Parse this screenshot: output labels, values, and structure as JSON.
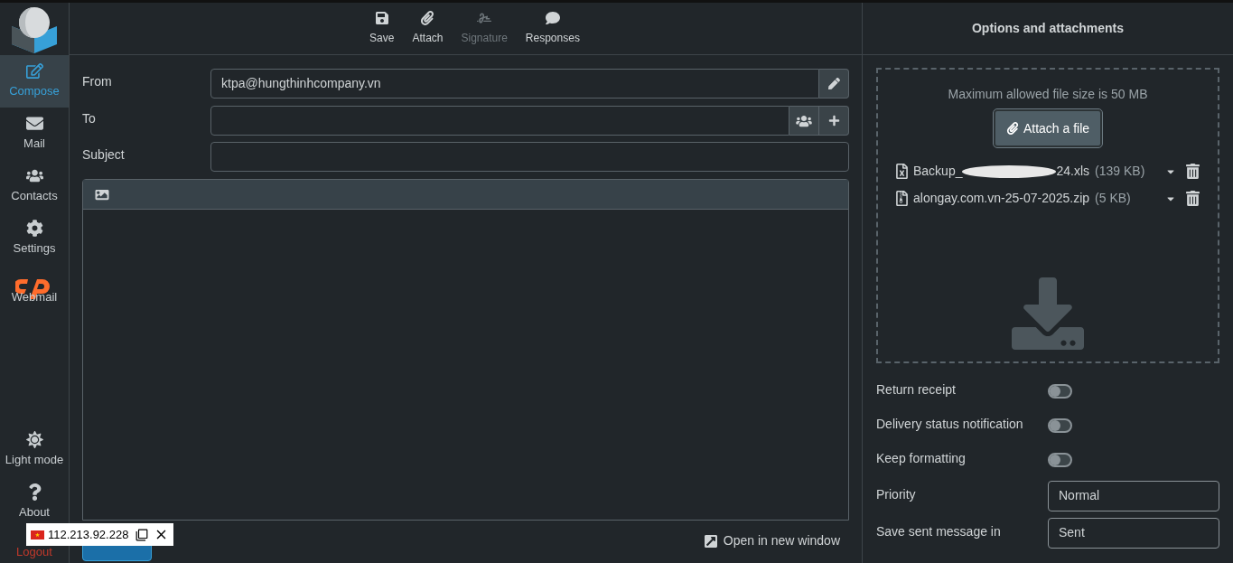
{
  "sidebar": {
    "items": [
      {
        "label": "Compose",
        "selected": true
      },
      {
        "label": "Mail",
        "selected": false
      },
      {
        "label": "Contacts",
        "selected": false
      },
      {
        "label": "Settings",
        "selected": false
      },
      {
        "label": "Webmail",
        "selected": false
      }
    ],
    "bottom_items": [
      {
        "label": "Light mode"
      },
      {
        "label": "About"
      },
      {
        "label": "Logout"
      }
    ]
  },
  "toolbar": [
    {
      "label": "Save",
      "disabled": false
    },
    {
      "label": "Attach",
      "disabled": false
    },
    {
      "label": "Signature",
      "disabled": true
    },
    {
      "label": "Responses",
      "disabled": false
    }
  ],
  "form": {
    "from": {
      "label": "From",
      "value": "ktpa@hungthinhcompany.vn"
    },
    "to": {
      "label": "To"
    },
    "subject": {
      "label": "Subject"
    }
  },
  "open_new_window": "Open in new window",
  "panel": {
    "title": "Options and attachments",
    "max_size": "Maximum allowed file size is 50 MB",
    "attach_button": "Attach a file",
    "attachments": [
      {
        "kind": "spreadsheet",
        "name_start": "Backup_",
        "name_end": "24.xls",
        "redacted": true,
        "size": "(139 KB)"
      },
      {
        "kind": "archive",
        "name_start": "alongay.com.vn-25-07-2025.zip",
        "redacted": false,
        "size": "(5 KB)"
      }
    ],
    "options": [
      {
        "kind": "toggle",
        "label": "Return receipt",
        "on": false
      },
      {
        "kind": "toggle",
        "label": "Delivery status notification",
        "on": false
      },
      {
        "kind": "toggle",
        "label": "Keep formatting",
        "on": false
      },
      {
        "kind": "select",
        "label": "Priority",
        "value": "Normal"
      },
      {
        "kind": "select",
        "label": "Save sent message in",
        "value": "Sent"
      }
    ]
  },
  "ip_popup": {
    "ip": "112.213.92.228"
  }
}
